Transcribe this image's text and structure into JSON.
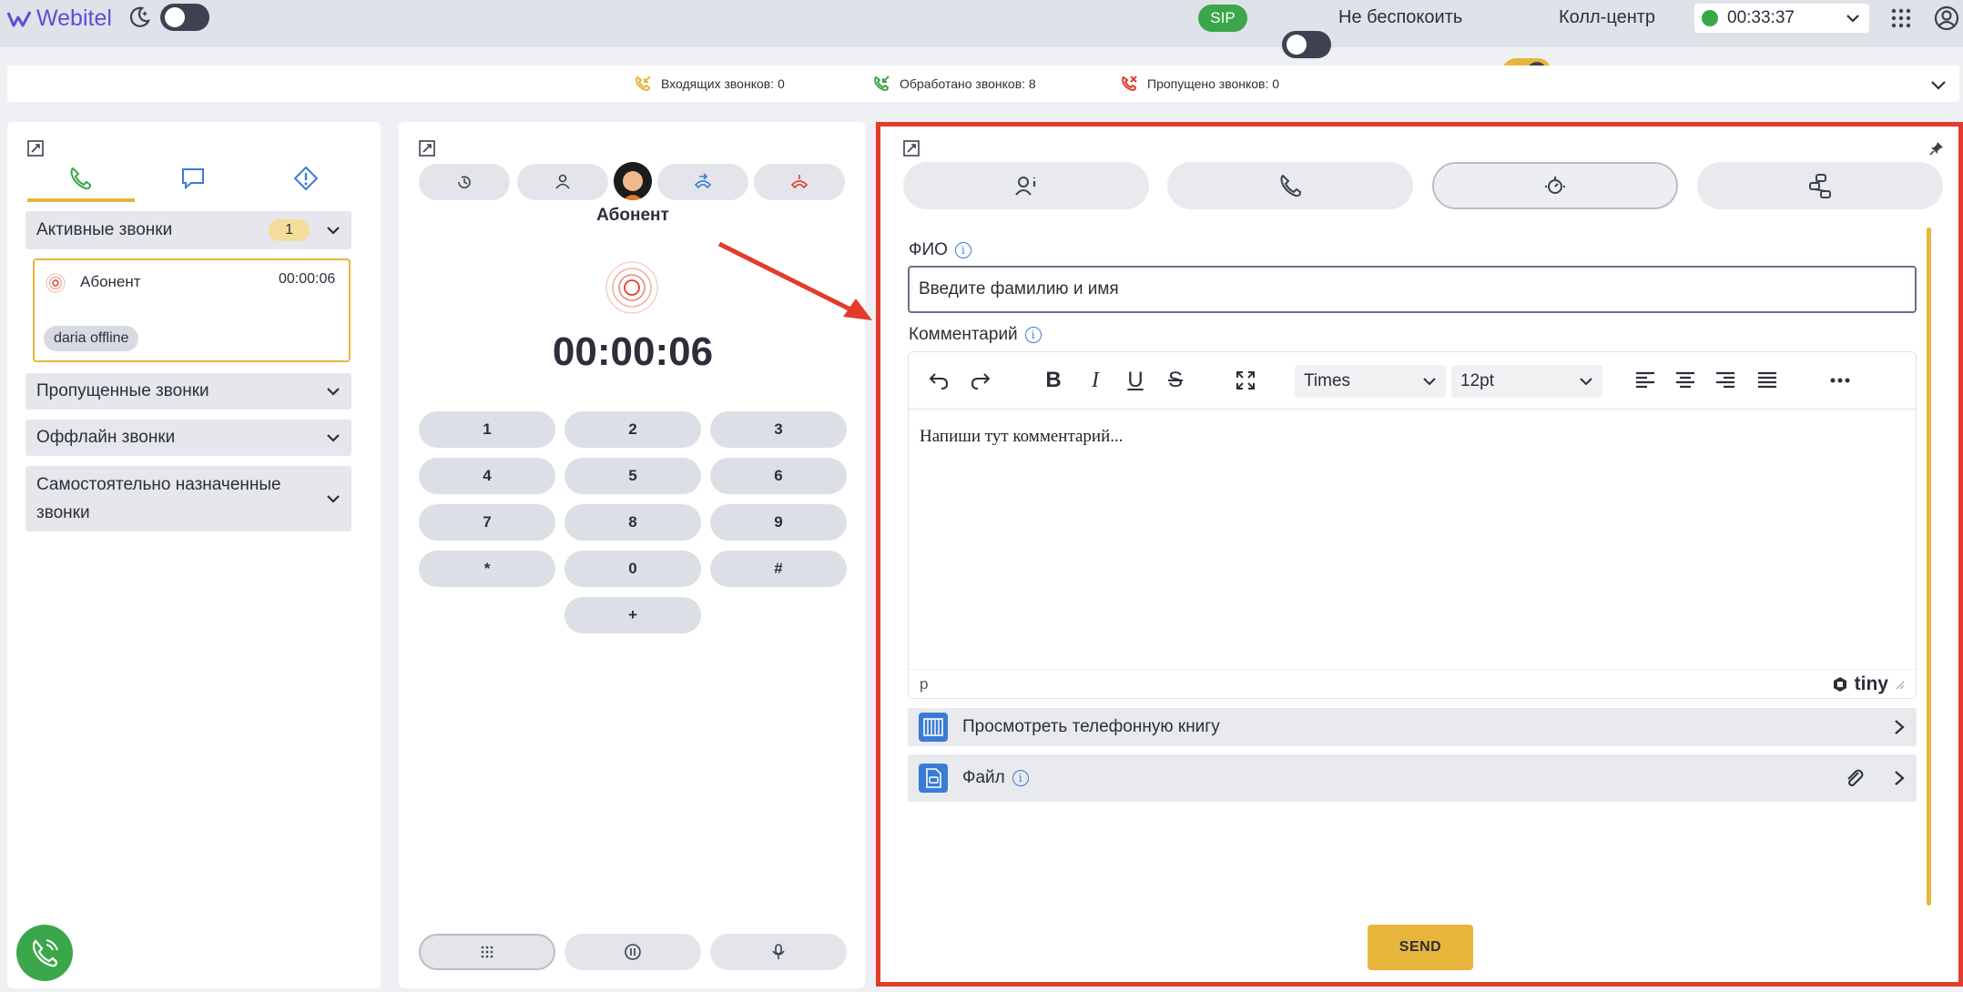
{
  "app": {
    "brand": "Webitel"
  },
  "topbar": {
    "sip_label": "SIP",
    "dnd_label": "Не беспокоить",
    "callcenter_label": "Колл-центр",
    "session_timer": "00:33:37"
  },
  "stats": {
    "incoming": "Входящих звонков: 0",
    "handled": "Обработано звонков: 8",
    "missed": "Пропущено звонков: 0"
  },
  "left": {
    "tabs": [
      "phone",
      "chat",
      "alert"
    ],
    "active_section": {
      "title": "Активные звонки",
      "count": "1"
    },
    "active_call": {
      "name": "Абонент",
      "duration": "00:00:06",
      "tag": "daria offline"
    },
    "sections": [
      "Пропущенные звонки",
      "Оффлайн звонки"
    ],
    "multiline_section": [
      "Самостоятельно назначенные",
      "звонки"
    ]
  },
  "middle": {
    "caller_name": "Абонент",
    "call_timer": "00:00:06",
    "keys": [
      "1",
      "2",
      "3",
      "4",
      "5",
      "6",
      "7",
      "8",
      "9",
      "*",
      "0",
      "#",
      "+"
    ]
  },
  "right": {
    "fio_label": "ФИО",
    "fio_value": "Введите фамилию и имя",
    "comment_label": "Комментарий",
    "font_family": "Times",
    "font_size": "12pt",
    "editor_text": "Напиши тут комментарий...",
    "status_path": "p",
    "editor_brand": "tiny",
    "phonebook_label": "Просмотреть телефонную книгу",
    "file_label": "Файл",
    "send_label": "SEND"
  },
  "colors": {
    "accent": "#e8b53c",
    "highlight_border": "#e23c2c",
    "status_green": "#3ca64a",
    "brand_purple": "#5b4fd9"
  }
}
